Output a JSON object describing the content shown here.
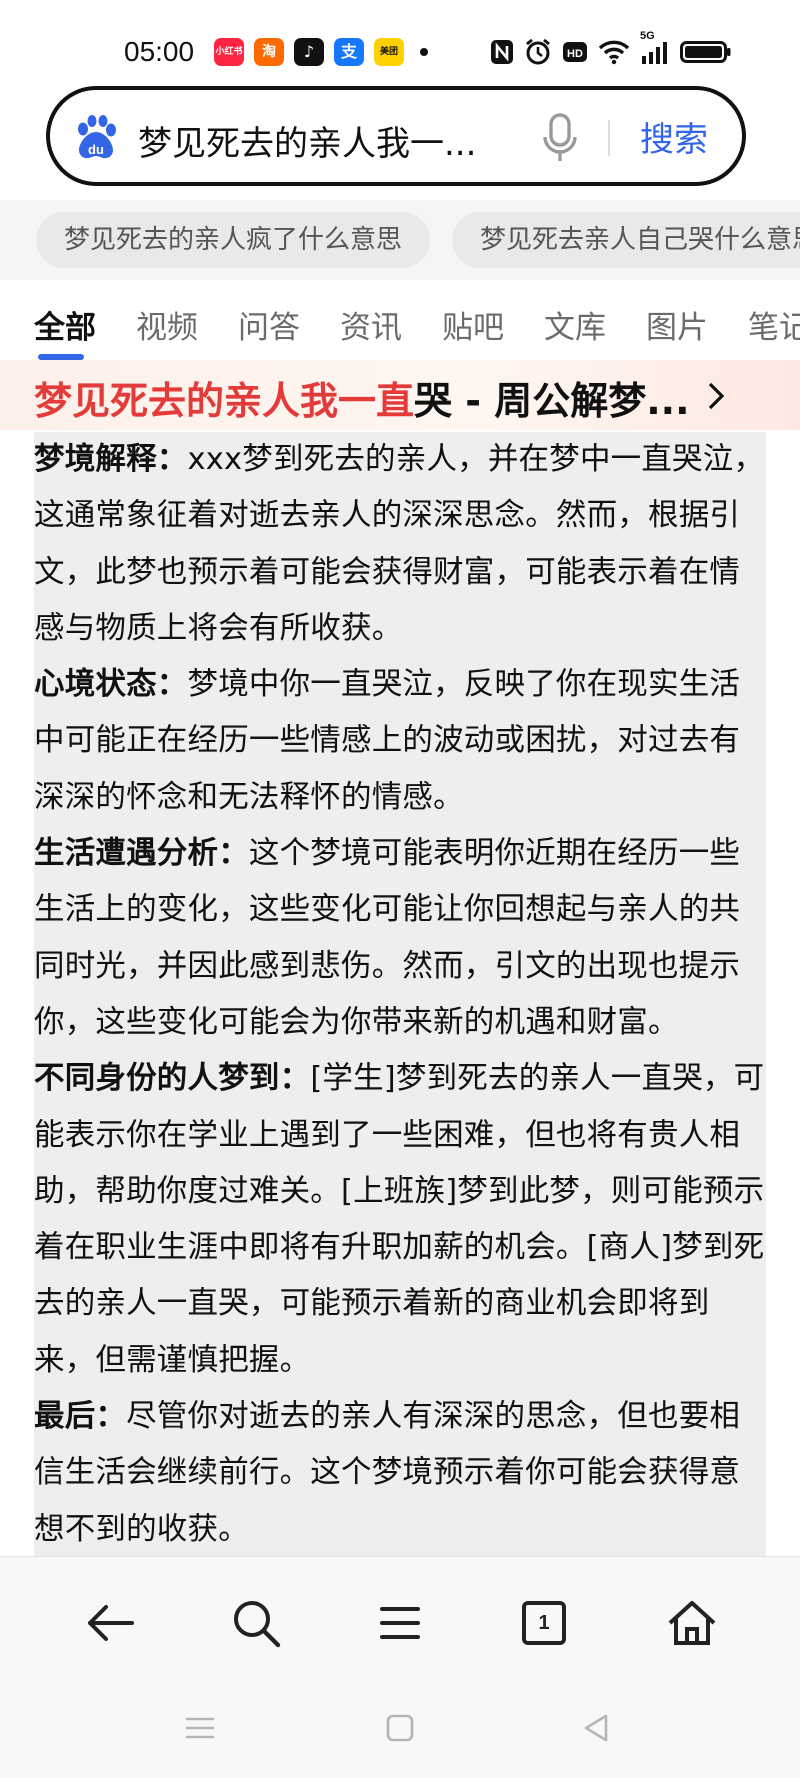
{
  "status": {
    "time": "05:00",
    "apps": [
      {
        "name": "xiaohongshu",
        "label": "小红书",
        "color": "#ff2442"
      },
      {
        "name": "taobao-flash",
        "label": "淘",
        "color": "#ff6a00"
      },
      {
        "name": "douyin",
        "label": "♪",
        "color": "#111111"
      },
      {
        "name": "alipay",
        "label": "支",
        "color": "#1677ff"
      },
      {
        "name": "meituan",
        "label": "美团",
        "color": "#ffd100"
      }
    ],
    "signal_label": "5G"
  },
  "search": {
    "query": "梦见死去的亲人我一...",
    "button_label": "搜索"
  },
  "suggestions": [
    "梦见死去的亲人疯了什么意思",
    "梦见死去亲人自己哭什么意思"
  ],
  "tabs": [
    "全部",
    "视频",
    "问答",
    "资讯",
    "贴吧",
    "文库",
    "图片",
    "笔记"
  ],
  "result": {
    "title_highlight": "梦见死去的亲人我一直",
    "title_rest": "哭 - 周公解梦..."
  },
  "article": [
    {
      "label": "梦境解释：",
      "text": "xxx梦到死去的亲人，并在梦中一直哭泣，这通常象征着对逝去亲人的深深思念。然而，根据引文，此梦也预示着可能会获得财富，可能表示着在情感与物质上将会有所收获。"
    },
    {
      "label": "心境状态：",
      "text": "梦境中你一直哭泣，反映了你在现实生活中可能正在经历一些情感上的波动或困扰，对过去有深深的怀念和无法释怀的情感。"
    },
    {
      "label": "生活遭遇分析：",
      "text": "这个梦境可能表明你近期在经历一些生活上的变化，这些变化可能让你回想起与亲人的共同时光，并因此感到悲伤。然而，引文的出现也提示你，这些变化可能会为你带来新的机遇和财富。"
    },
    {
      "label": "不同身份的人梦到：",
      "text": "[学生]梦到死去的亲人一直哭，可能表示你在学业上遇到了一些困难，但也将有贵人相助，帮助你度过难关。[上班族]梦到此梦，则可能预示着在职业生涯中即将有升职加薪的机会。[商人]梦到死去的亲人一直哭，可能预示着新的商业机会即将到来，但需谨慎把握。"
    },
    {
      "label": "最后：",
      "text": "尽管你对逝去的亲人有深深的思念，但也要相信生活会继续前行。这个梦境预示着你可能会获得意想不到的收获。"
    }
  ],
  "bottom_nav": {
    "tab_count": "1"
  }
}
